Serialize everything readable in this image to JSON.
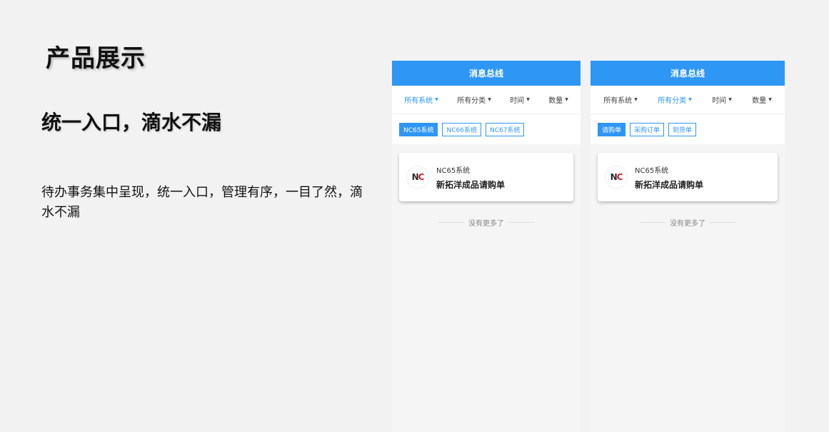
{
  "page": {
    "title": "产品展示",
    "subtitle": "统一入口，滴水不漏",
    "description": "待办事务集中呈现，统一入口，管理有序，一目了然，滴水不漏"
  },
  "colors": {
    "accent": "#2e96f5",
    "background": "#f2f2f2"
  },
  "phones": [
    {
      "header": "消息总线",
      "filters": [
        {
          "label": "所有系统",
          "active": true
        },
        {
          "label": "所有分类",
          "active": false
        },
        {
          "label": "时间",
          "active": false
        },
        {
          "label": "数量",
          "active": false
        }
      ],
      "chips": [
        {
          "label": "NC65系统",
          "active": true
        },
        {
          "label": "NC66系统",
          "active": false
        },
        {
          "label": "NC67系统",
          "active": false
        }
      ],
      "card": {
        "logo": "NC",
        "system": "NC65系统",
        "title": "新拓洋成品请购单"
      },
      "no_more": "没有更多了"
    },
    {
      "header": "消息总线",
      "filters": [
        {
          "label": "所有系统",
          "active": false
        },
        {
          "label": "所有分类",
          "active": true
        },
        {
          "label": "时间",
          "active": false
        },
        {
          "label": "数量",
          "active": false
        }
      ],
      "chips": [
        {
          "label": "请购单",
          "active": true
        },
        {
          "label": "采购订单",
          "active": false
        },
        {
          "label": "到货单",
          "active": false
        }
      ],
      "card": {
        "logo": "NC",
        "system": "NC65系统",
        "title": "新拓洋成品请购单"
      },
      "no_more": "没有更多了"
    }
  ]
}
